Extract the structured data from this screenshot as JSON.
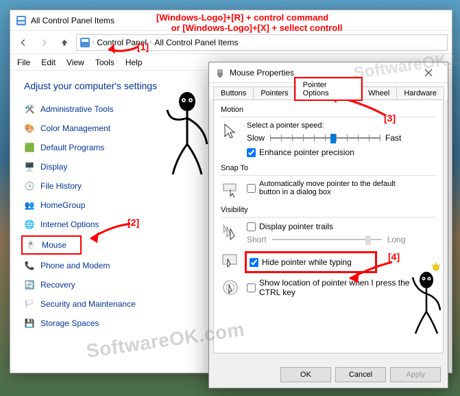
{
  "cp_window": {
    "title": "All Control Panel Items",
    "breadcrumb": {
      "root": "Control Panel",
      "current": "All Control Panel Items"
    },
    "menubar": [
      "File",
      "Edit",
      "View",
      "Tools",
      "Help"
    ],
    "heading": "Adjust your computer's settings",
    "items": [
      {
        "label": "Administrative Tools",
        "icon": "tools-icon"
      },
      {
        "label": "Color Management",
        "icon": "color-icon"
      },
      {
        "label": "Default Programs",
        "icon": "defprog-icon"
      },
      {
        "label": "Display",
        "icon": "display-icon"
      },
      {
        "label": "File History",
        "icon": "filehist-icon"
      },
      {
        "label": "HomeGroup",
        "icon": "homegroup-icon"
      },
      {
        "label": "Internet Options",
        "icon": "internet-icon"
      },
      {
        "label": "Mouse",
        "icon": "mouse-icon"
      },
      {
        "label": "Phone and Modem",
        "icon": "phone-icon"
      },
      {
        "label": "Recovery",
        "icon": "recovery-icon"
      },
      {
        "label": "Security and Maintenance",
        "icon": "security-icon"
      },
      {
        "label": "Storage Spaces",
        "icon": "storage-icon"
      }
    ]
  },
  "dialog": {
    "title": "Mouse Properties",
    "tabs": [
      "Buttons",
      "Pointers",
      "Pointer Options",
      "Wheel",
      "Hardware"
    ],
    "active_tab_index": 2,
    "motion": {
      "heading": "Motion",
      "label": "Select a pointer speed:",
      "slow": "Slow",
      "fast": "Fast",
      "enhance": "Enhance pointer precision",
      "enhance_checked": true,
      "speed_value": 6,
      "speed_max": 11
    },
    "snap": {
      "heading": "Snap To",
      "label": "Automatically move pointer to the default button in a dialog box",
      "checked": false
    },
    "visibility": {
      "heading": "Visibility",
      "trails_label": "Display pointer trails",
      "trails_checked": false,
      "short": "Short",
      "long": "Long",
      "hide_label": "Hide pointer while typing",
      "hide_checked": true,
      "ctrl_label": "Show location of pointer when I press the CTRL key",
      "ctrl_checked": false
    },
    "buttons": {
      "ok": "OK",
      "cancel": "Cancel",
      "apply": "Apply"
    }
  },
  "annotations": {
    "top_text": "[Windows-Logo]+[R] + control command\n      or [Windows-Logo]+[X] + sellect controll",
    "marker1": "[1]",
    "marker2": "[2]",
    "marker3": "[3]",
    "marker4": "[4]",
    "watermark": "SoftwareOK.com"
  }
}
